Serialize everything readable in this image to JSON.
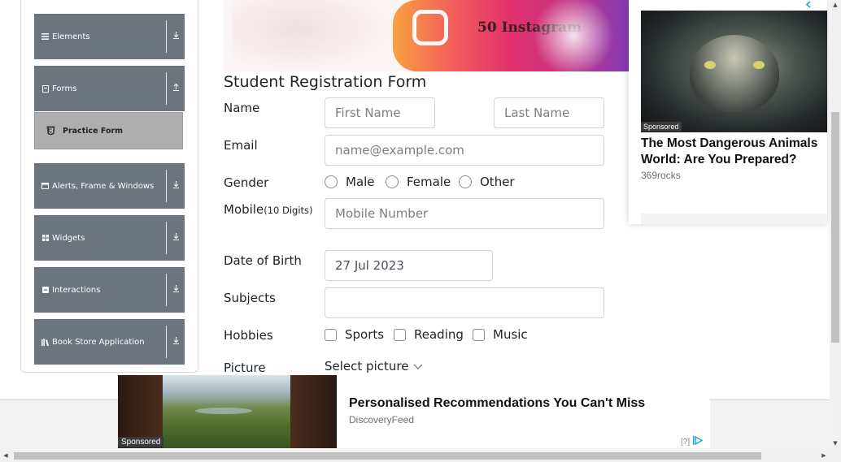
{
  "sidebar": {
    "groups": [
      {
        "label": "Elements",
        "icon": "list-icon",
        "arrow": "download-arrow-icon"
      },
      {
        "label": "Forms",
        "icon": "form-icon",
        "arrow": "upload-arrow-icon"
      },
      {
        "label": "Alerts, Frame & Windows",
        "icon": "window-icon",
        "arrow": "download-arrow-icon"
      },
      {
        "label": "Widgets",
        "icon": "grid-icon",
        "arrow": "download-arrow-icon"
      },
      {
        "label": "Interactions",
        "icon": "interaction-icon",
        "arrow": "download-arrow-icon"
      },
      {
        "label": "Book Store Application",
        "icon": "book-icon",
        "arrow": "download-arrow-icon"
      }
    ],
    "active_item": {
      "label": "Practice Form",
      "icon": "html5-shield-icon"
    }
  },
  "banner": {
    "text": "50 Instagram"
  },
  "form": {
    "title": "Student Registration Form",
    "name_label": "Name",
    "first_name_placeholder": "First Name",
    "last_name_placeholder": "Last Name",
    "email_label": "Email",
    "email_placeholder": "name@example.com",
    "gender_label": "Gender",
    "gender_options": [
      "Male",
      "Female",
      "Other"
    ],
    "mobile_label": "Mobile",
    "mobile_hint": "(10 Digits)",
    "mobile_placeholder": "Mobile Number",
    "dob_label": "Date of Birth",
    "dob_value": "27 Jul 2023",
    "subjects_label": "Subjects",
    "hobbies_label": "Hobbies",
    "hobby_options": [
      "Sports",
      "Reading",
      "Music"
    ],
    "picture_label": "Picture",
    "picture_button": "Select picture"
  },
  "ad_right": {
    "sponsored": "Sponsored",
    "headline": "The Most Dangerous Animals World: Are You Prepared?",
    "source": "369rocks",
    "close_icon": "ad-close-icon"
  },
  "ad_bottom": {
    "sponsored": "Sponsored",
    "headline": "Personalised Recommendations You Can't Miss",
    "source": "DiscoveryFeed",
    "adchoice": "[?]"
  },
  "colors": {
    "sidebar_header": "#6c757d",
    "active_item": "#aeaeae",
    "text": "#212529",
    "input_border": "#ced4da",
    "adchoice_accent": "#1aa3d6"
  }
}
